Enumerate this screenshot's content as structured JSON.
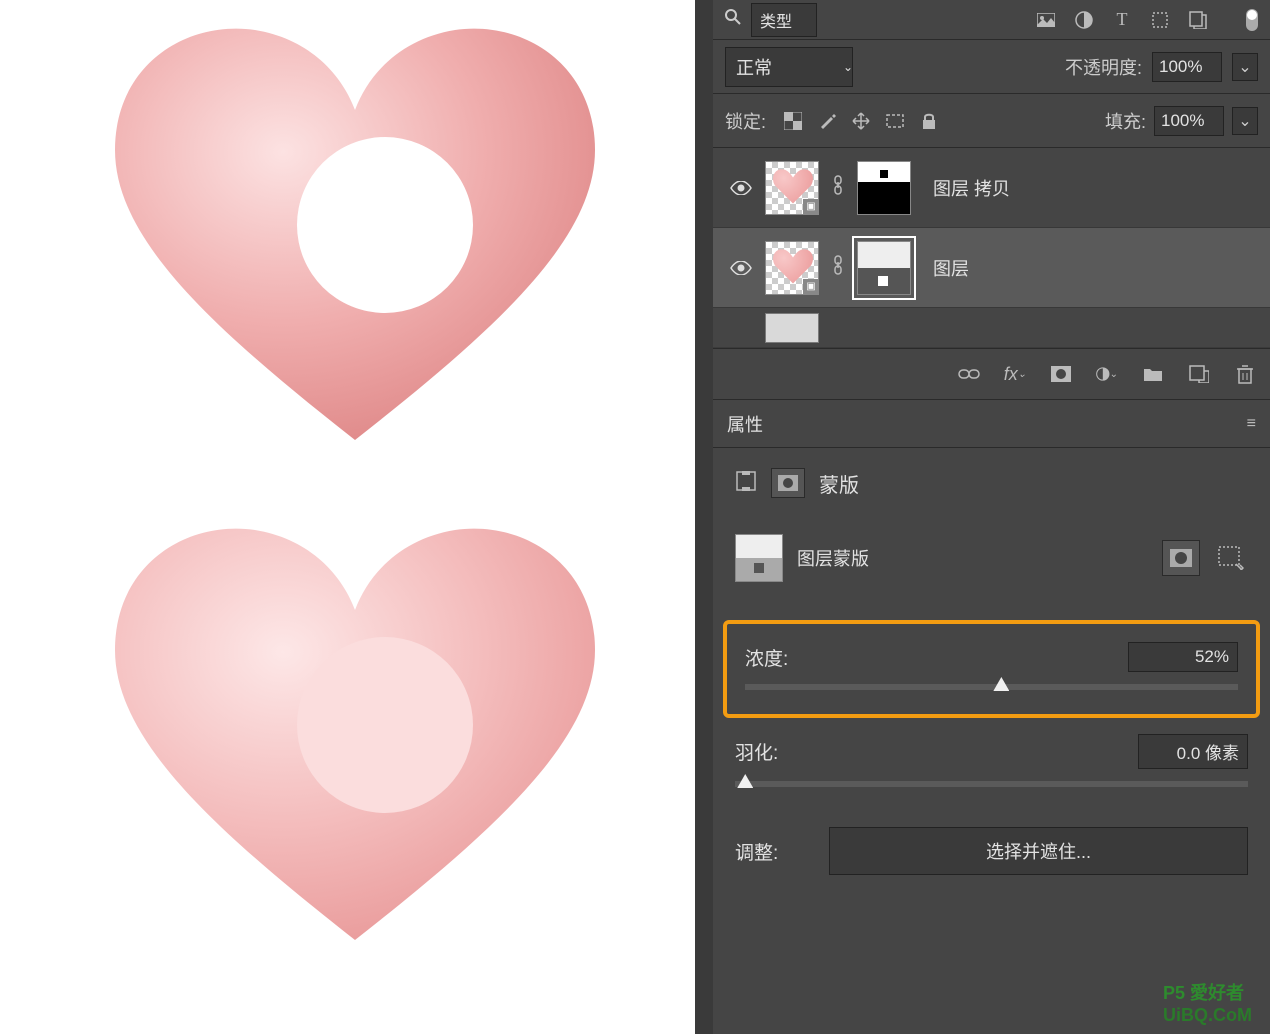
{
  "filter": {
    "label": "类型"
  },
  "blend": {
    "mode": "正常",
    "opacity_label": "不透明度:",
    "opacity_value": "100%"
  },
  "lock": {
    "label": "锁定:",
    "fill_label": "填充:",
    "fill_value": "100%"
  },
  "layers": {
    "items": [
      {
        "name": "图层 拷贝"
      },
      {
        "name": "图层"
      }
    ]
  },
  "properties": {
    "title": "属性",
    "kind_label": "蒙版",
    "mask_type_label": "图层蒙版"
  },
  "density": {
    "label": "浓度:",
    "value": "52%",
    "pos": 52
  },
  "feather": {
    "label": "羽化:",
    "value": "0.0 像素",
    "pos": 0
  },
  "adjust": {
    "label": "调整:",
    "button": "选择并遮住..."
  },
  "watermark": {
    "line1": "P5 愛好者",
    "line2": "UiBQ.CoM"
  }
}
